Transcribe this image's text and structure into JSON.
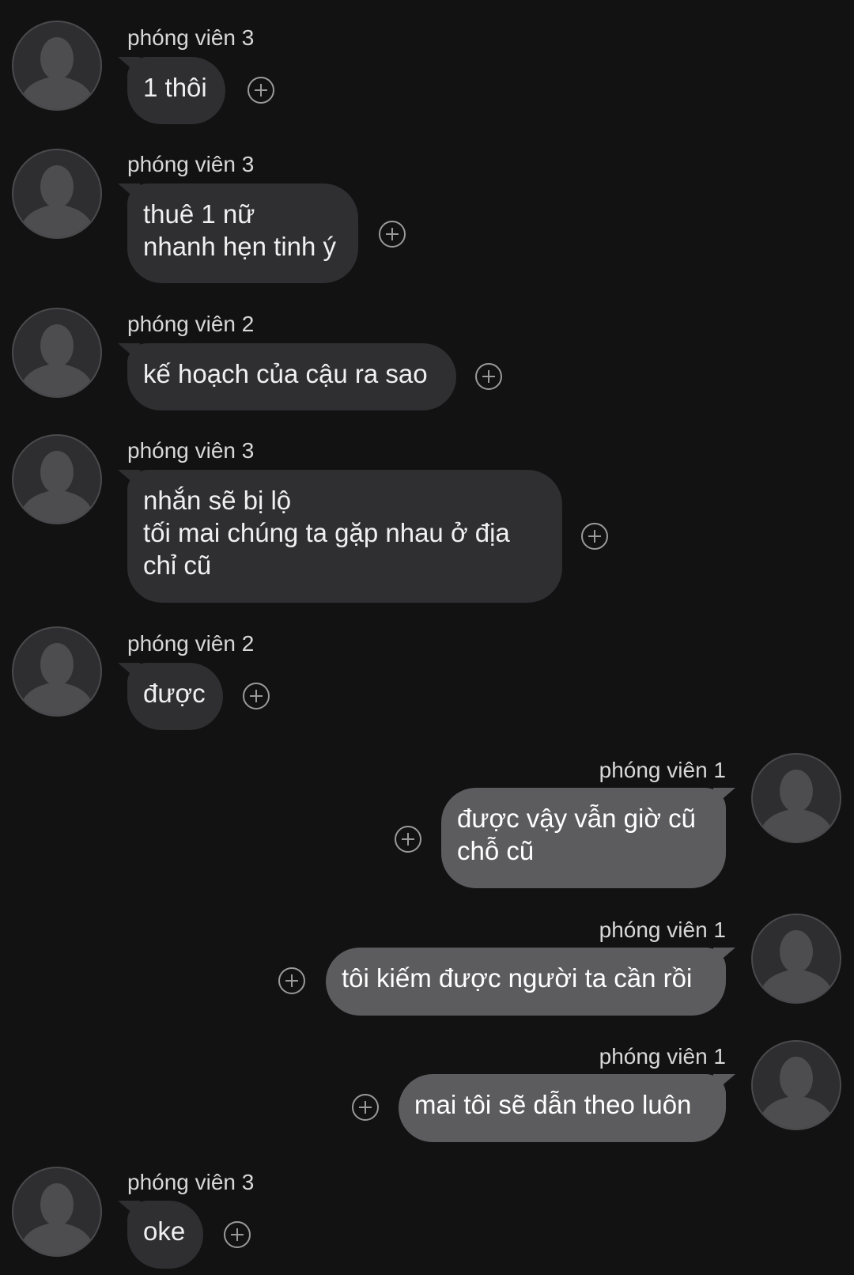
{
  "messages": [
    {
      "sender": "phóng viên 3",
      "text": "1 thôi",
      "direction": "incoming",
      "avatar_icon": "default-person-silhouette"
    },
    {
      "sender": "phóng viên 3",
      "text": "thuê 1 nữ\nnhanh hẹn tinh ý",
      "direction": "incoming",
      "avatar_icon": "default-person-silhouette"
    },
    {
      "sender": "phóng viên 2",
      "text": "kế hoạch của cậu ra sao",
      "direction": "incoming",
      "avatar_icon": "default-person-silhouette"
    },
    {
      "sender": "phóng viên 3",
      "text": "nhắn sẽ bị lộ\ntối mai chúng ta gặp nhau ở địa\nchỉ cũ",
      "direction": "incoming",
      "avatar_icon": "default-person-silhouette"
    },
    {
      "sender": "phóng viên 2",
      "text": "được",
      "direction": "incoming",
      "avatar_icon": "default-person-silhouette"
    },
    {
      "sender": "phóng viên 1",
      "text": "được vậy vẫn giờ cũ\nchỗ cũ",
      "direction": "outgoing",
      "avatar_icon": "default-person-silhouette"
    },
    {
      "sender": "phóng viên 1",
      "text": "tôi kiếm được người ta cần rồi",
      "direction": "outgoing",
      "avatar_icon": "default-person-silhouette"
    },
    {
      "sender": "phóng viên 1",
      "text": "mai tôi sẽ dẫn theo luôn",
      "direction": "outgoing",
      "avatar_icon": "default-person-silhouette"
    },
    {
      "sender": "phóng viên 3",
      "text": "oke",
      "direction": "incoming",
      "avatar_icon": "default-person-silhouette"
    }
  ],
  "react_icon": "add-reaction-plus-icon",
  "colors": {
    "background": "#121213",
    "incoming_bubble": "#2f2f31",
    "outgoing_bubble": "#5c5c5e",
    "text": "#f0f0f0"
  }
}
